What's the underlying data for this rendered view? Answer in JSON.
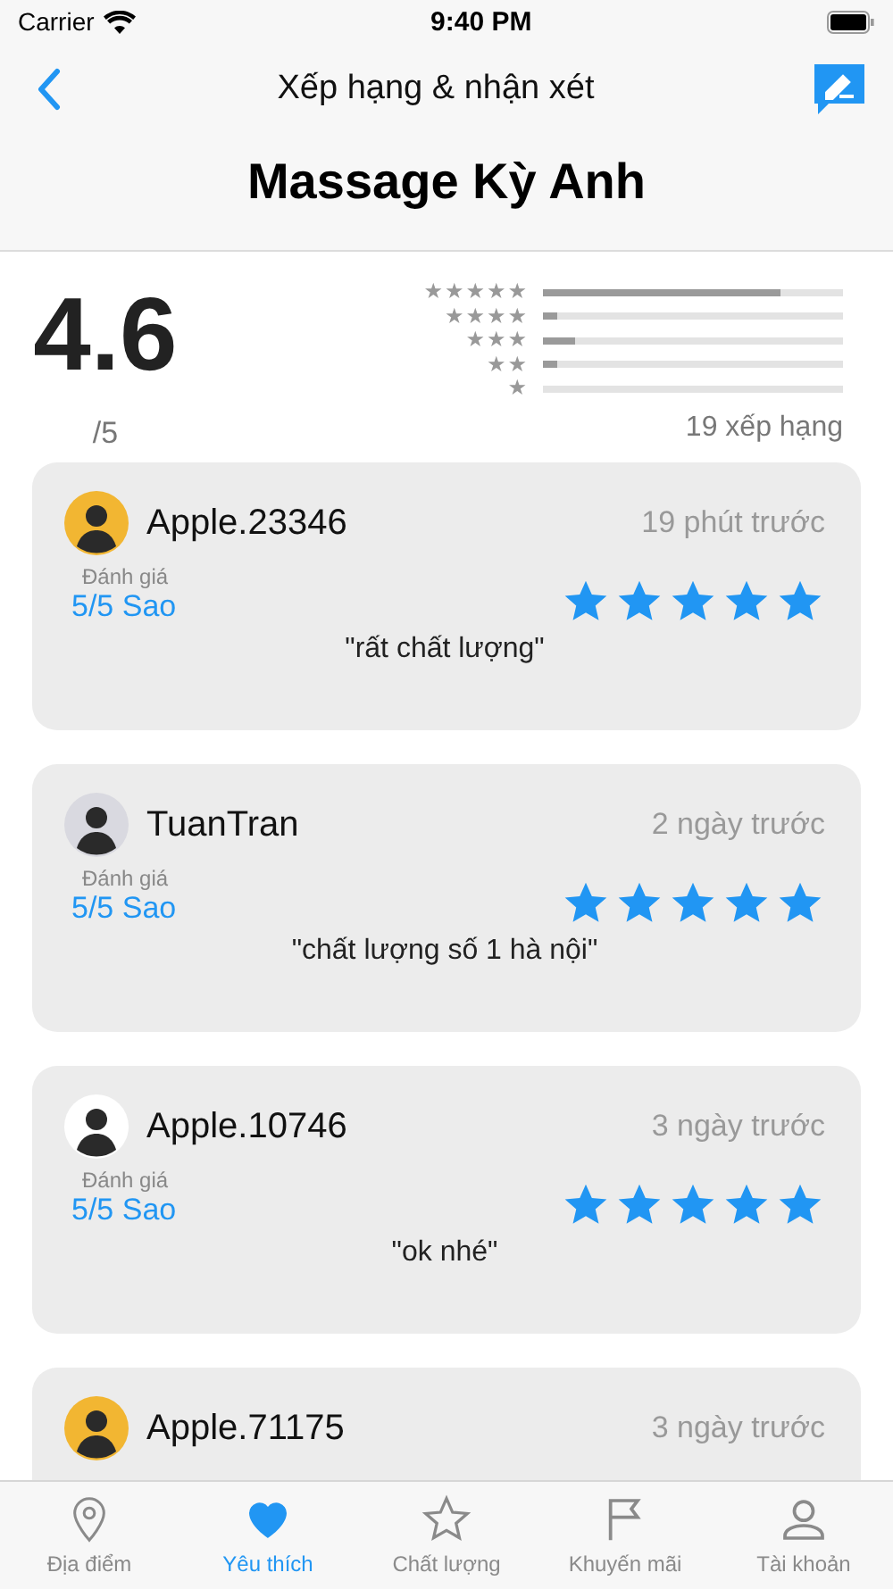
{
  "status_bar": {
    "carrier": "Carrier",
    "time": "9:40 PM"
  },
  "nav": {
    "title": "Xếp hạng & nhận xét",
    "place": "Massage Kỳ Anh"
  },
  "summary": {
    "score": "4.6",
    "out_of": "/5",
    "count": "19 xếp hạng",
    "histogram": [
      {
        "rank": "★★★★★",
        "level": 0.79
      },
      {
        "rank": "★★★★",
        "level": 0.05
      },
      {
        "rank": "★★★",
        "level": 0.11
      },
      {
        "rank": "★★",
        "level": 0.05
      },
      {
        "rank": "★"
      }
    ]
  },
  "reviews": [
    {
      "name": "Apple.23346",
      "time": "19 phút trước",
      "color": "#f2b632",
      "label": "Đánh giá",
      "rating": "5/5 Sao",
      "stars": 5,
      "comment": "\"rất chất lượng\""
    },
    {
      "name": "TuanTran",
      "time": "2 ngày trước",
      "color": "#d9d9e0",
      "label": "Đánh giá",
      "rating": "5/5 Sao",
      "stars": 5,
      "comment": "\"chất lượng số 1 hà nội\""
    },
    {
      "name": "Apple.10746",
      "time": "3 ngày trước",
      "color": "#ffffff",
      "label": "Đánh giá",
      "rating": "5/5 Sao",
      "stars": 5,
      "comment": "\"ok nhé\""
    },
    {
      "name": "Apple.71175",
      "time": "3 ngày trước",
      "color": "#f2b632"
    }
  ],
  "tabs": [
    {
      "kind": "pin",
      "label": "Địa điểm",
      "selected": false
    },
    {
      "kind": "heart",
      "label": "Yêu thích",
      "selected": true
    },
    {
      "kind": "star",
      "label": "Chất lượng",
      "selected": false
    },
    {
      "kind": "flag",
      "label": "Khuyến mãi",
      "selected": false
    },
    {
      "kind": "person",
      "label": "Tài khoản",
      "selected": false
    }
  ]
}
